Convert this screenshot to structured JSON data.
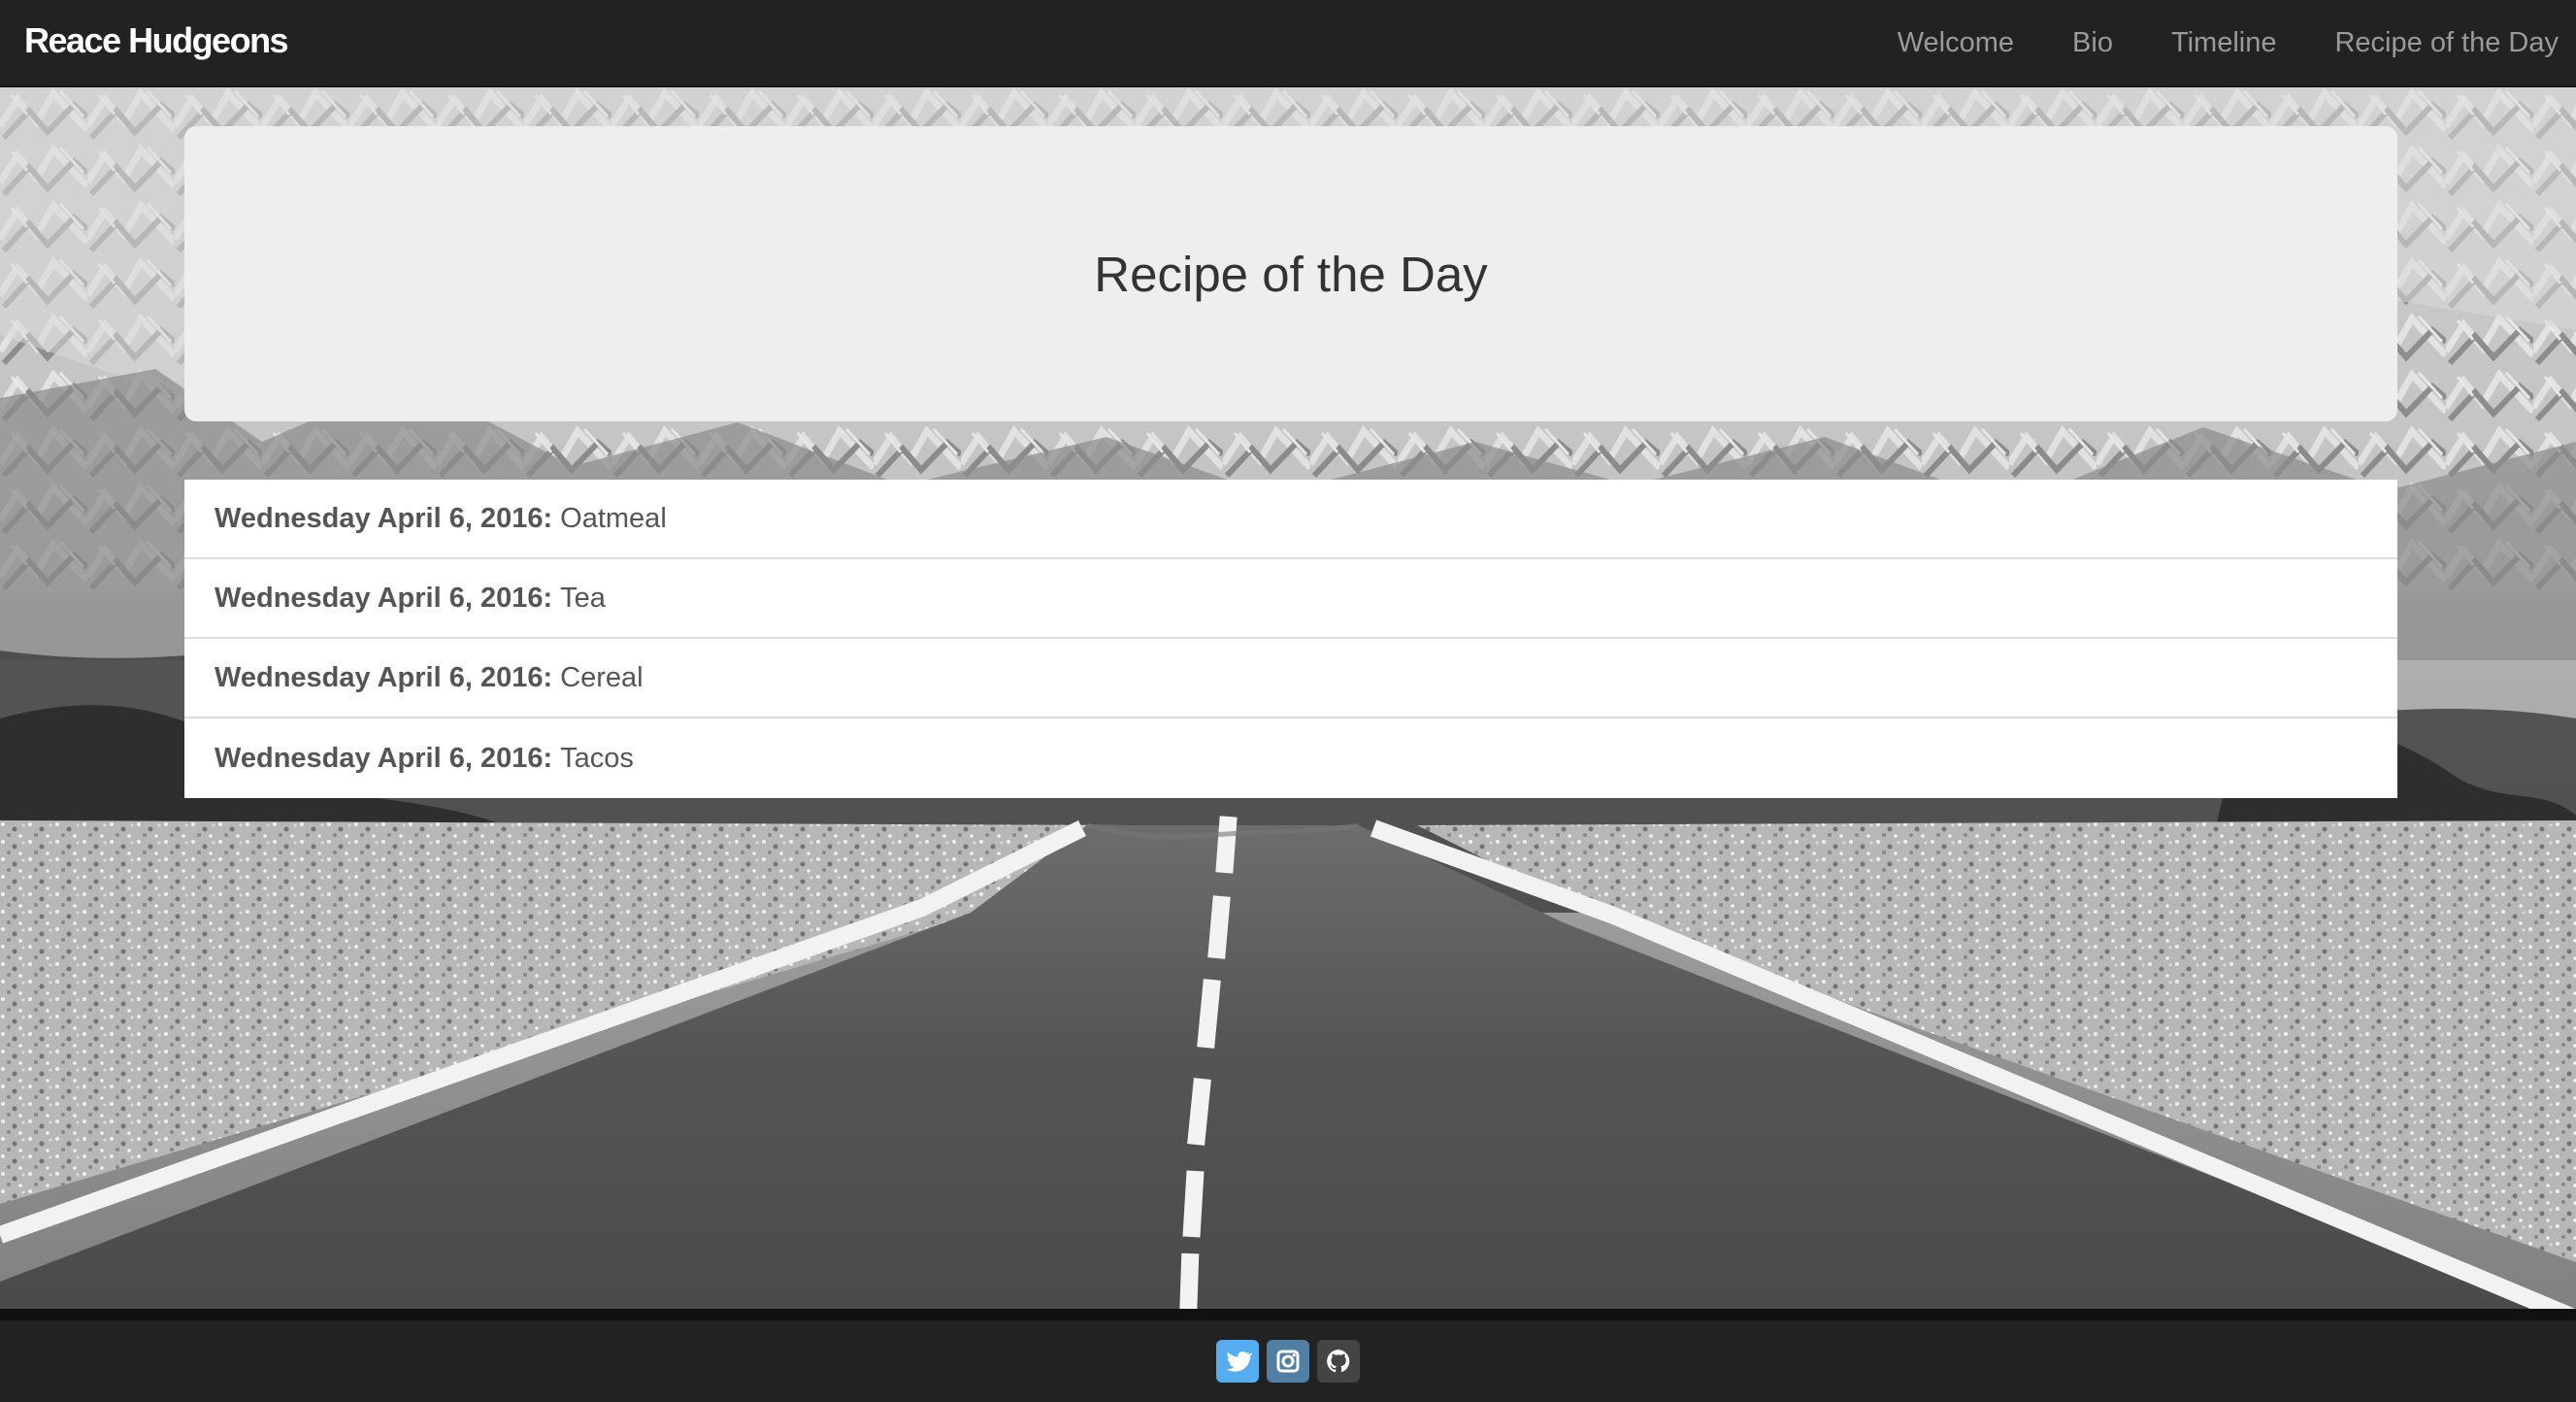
{
  "navbar": {
    "brand": "Reace Hudgeons",
    "links": [
      "Welcome",
      "Bio",
      "Timeline",
      "Recipe of the Day"
    ]
  },
  "page": {
    "title": "Recipe of the Day"
  },
  "recipes": [
    {
      "date": "Wednesday April 6, 2016:",
      "name": "Oatmeal"
    },
    {
      "date": "Wednesday April 6, 2016:",
      "name": "Tea"
    },
    {
      "date": "Wednesday April 6, 2016:",
      "name": "Cereal"
    },
    {
      "date": "Wednesday April 6, 2016:",
      "name": "Tacos"
    }
  ],
  "footer": {
    "social": [
      {
        "icon": "twitter-icon",
        "color": "#55acee"
      },
      {
        "icon": "instagram-icon",
        "color": "#517fa4"
      },
      {
        "icon": "github-icon",
        "color": "#444444"
      }
    ]
  },
  "colors": {
    "navbar": "#222222",
    "jumbotron": "#eeeeee",
    "text": "#333333"
  }
}
